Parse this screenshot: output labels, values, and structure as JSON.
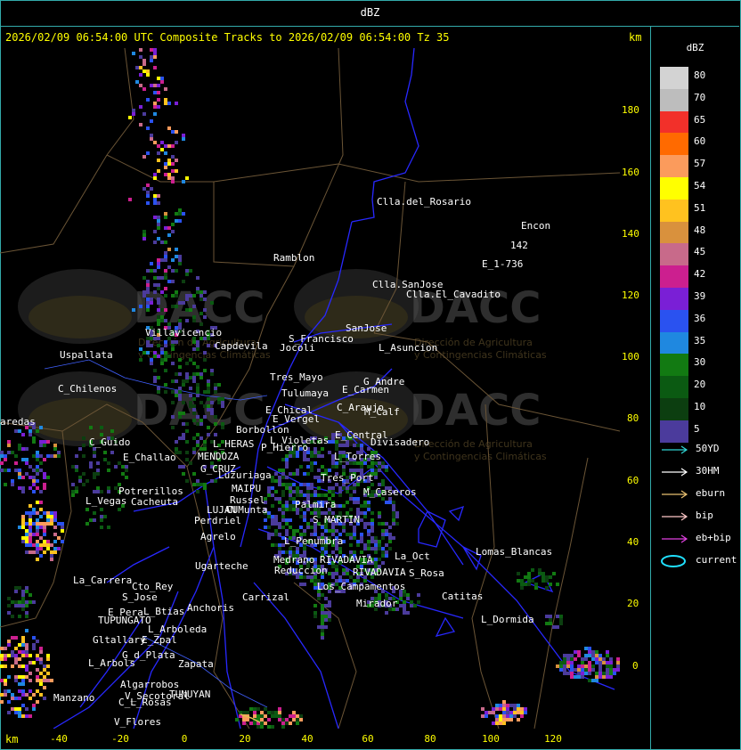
{
  "window": {
    "title": "dBZ"
  },
  "header": {
    "text": "2026/02/09 06:54:00 UTC Composite Tracks to 2026/02/09 06:54:00 Tz 35",
    "km_label": "km"
  },
  "axes": {
    "x_unit": "km",
    "y_unit": "km",
    "x_ticks": [
      "-40",
      "-20",
      "0",
      "20",
      "40",
      "60",
      "80",
      "100",
      "120"
    ],
    "y_ticks": [
      "180",
      "160",
      "140",
      "120",
      "100",
      "80",
      "60",
      "40",
      "20",
      "0"
    ]
  },
  "legend": {
    "title": "dBZ",
    "scale": [
      {
        "label": "80",
        "color": "#d3d3d3"
      },
      {
        "label": "70",
        "color": "#bdbdbd"
      },
      {
        "label": "65",
        "color": "#f2302a"
      },
      {
        "label": "60",
        "color": "#ff6a00"
      },
      {
        "label": "57",
        "color": "#fb9b5c"
      },
      {
        "label": "54",
        "color": "#ffff00"
      },
      {
        "label": "51",
        "color": "#ffc21f"
      },
      {
        "label": "48",
        "color": "#d9913d"
      },
      {
        "label": "45",
        "color": "#c86a8a"
      },
      {
        "label": "42",
        "color": "#cc1f8f"
      },
      {
        "label": "39",
        "color": "#7a1fd6"
      },
      {
        "label": "36",
        "color": "#2a52f0"
      },
      {
        "label": "35",
        "color": "#1f88e0"
      },
      {
        "label": "30",
        "color": "#127a12"
      },
      {
        "label": "20",
        "color": "#0b5a12"
      },
      {
        "label": "10",
        "color": "#0c3e10"
      },
      {
        "label": "5",
        "color": "#4b3b9c"
      }
    ],
    "tracks": [
      {
        "label": "50YD",
        "color": "#2fd4d4"
      },
      {
        "label": "30HM",
        "color": "#ffffff"
      },
      {
        "label": "eburn",
        "color": "#e8c070"
      },
      {
        "label": "bip",
        "color": "#ffc8c8"
      },
      {
        "label": "eb+bip",
        "color": "#e040e0"
      },
      {
        "label": "current",
        "color": "#20e0ff"
      }
    ]
  },
  "watermark": {
    "logo_text": "DACC",
    "line1": "Dirección de Agricultura",
    "line2": "y Contingencias Climáticas"
  },
  "places": [
    {
      "name": "Clla.del_Rosario"
    },
    {
      "name": "Encon"
    },
    {
      "name": "142"
    },
    {
      "name": "E_1-736"
    },
    {
      "name": "Ramblon"
    },
    {
      "name": "Clla.SanJose"
    },
    {
      "name": "Clla.El_Cavadito"
    },
    {
      "name": "Villavicencio"
    },
    {
      "name": "Capdevila"
    },
    {
      "name": "S_Francisco"
    },
    {
      "name": "Jocoli"
    },
    {
      "name": "SanJose"
    },
    {
      "name": "L_Asuncion"
    },
    {
      "name": "Uspallata"
    },
    {
      "name": "Tres_Mayo"
    },
    {
      "name": "G_Andre"
    },
    {
      "name": "E_Carmen"
    },
    {
      "name": "C_Chilenos"
    },
    {
      "name": "Tulumaya"
    },
    {
      "name": "C_Araujo"
    },
    {
      "name": "E_Chical"
    },
    {
      "name": "E_Vergel"
    },
    {
      "name": "M_Calf"
    },
    {
      "name": "aredas"
    },
    {
      "name": "Borbollon"
    },
    {
      "name": "L_Violetas"
    },
    {
      "name": "E_Central"
    },
    {
      "name": "C_Guido"
    },
    {
      "name": "L_HERAS"
    },
    {
      "name": "P_Hierro"
    },
    {
      "name": "Divisadero"
    },
    {
      "name": "E_Challao"
    },
    {
      "name": "MENDOZA"
    },
    {
      "name": "L_Torres"
    },
    {
      "name": "G_CRUZ"
    },
    {
      "name": "Luzuriaga"
    },
    {
      "name": "Tres_Port"
    },
    {
      "name": "MAIPU"
    },
    {
      "name": "Potrerillos"
    },
    {
      "name": "Russel"
    },
    {
      "name": "L_Vegas"
    },
    {
      "name": "Cacheuta"
    },
    {
      "name": "LUJAN"
    },
    {
      "name": "CUMunta"
    },
    {
      "name": "Palmira"
    },
    {
      "name": "M_Caseros"
    },
    {
      "name": "S_MARTIN"
    },
    {
      "name": "Perdriel"
    },
    {
      "name": "Agrelo"
    },
    {
      "name": "L_Penumbra"
    },
    {
      "name": "RIVADAVIA"
    },
    {
      "name": "Ugarteche"
    },
    {
      "name": "Medrano"
    },
    {
      "name": "Reduccion"
    },
    {
      "name": "RIVADAVIA"
    },
    {
      "name": "La_Oct"
    },
    {
      "name": "Lomas_Blancas"
    },
    {
      "name": "La_Carrera"
    },
    {
      "name": "Cto_Rey"
    },
    {
      "name": "S_Jose"
    },
    {
      "name": "S_Rosa"
    },
    {
      "name": "Los_Campamentos"
    },
    {
      "name": "Catitas"
    },
    {
      "name": "Carrizal"
    },
    {
      "name": "Anchoris"
    },
    {
      "name": "L_Btias"
    },
    {
      "name": "Mirador"
    },
    {
      "name": "E_Pera"
    },
    {
      "name": "TUPUNGATO"
    },
    {
      "name": "L_Dormida"
    },
    {
      "name": "L_Arboleda"
    },
    {
      "name": "Gltallary"
    },
    {
      "name": "E_Zpal"
    },
    {
      "name": "G_d_Plata"
    },
    {
      "name": "L_Arbols"
    },
    {
      "name": "Zapata"
    },
    {
      "name": "Algarrobos"
    },
    {
      "name": "V_Secotoral"
    },
    {
      "name": "Manzano"
    },
    {
      "name": "C_L_Rosas"
    },
    {
      "name": "TUNUYAN"
    },
    {
      "name": "V_Flores"
    }
  ]
}
